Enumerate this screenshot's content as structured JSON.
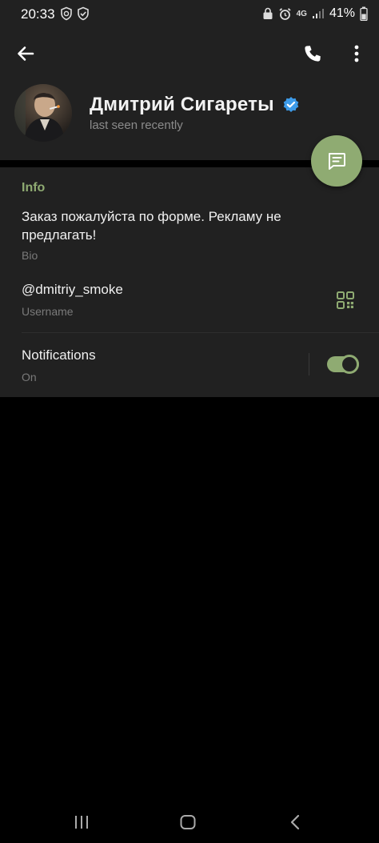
{
  "status_bar": {
    "time": "20:33",
    "network": "4G",
    "battery": "41%",
    "icons": [
      "shield-icon",
      "shield-check-icon",
      "lock-icon",
      "alarm-icon",
      "signal-icon",
      "battery-icon"
    ]
  },
  "toolbar": {
    "back_icon": "arrow-left-icon",
    "call_icon": "phone-icon",
    "more_icon": "more-vertical-icon"
  },
  "profile": {
    "name": "Дмитрий Сигареты",
    "status": "last seen recently",
    "verified": true
  },
  "fab": {
    "icon": "message-icon"
  },
  "info": {
    "title": "Info",
    "bio": "Заказ пожалуйста по форме. Рекламу не предлагать!",
    "bio_label": "Bio",
    "username": "@dmitriy_smoke",
    "username_label": "Username",
    "qr_icon": "qr-code-icon",
    "notifications_label": "Notifications",
    "notifications_value": "On",
    "notifications_enabled": true
  },
  "navigation": {
    "items": [
      "recents-icon",
      "home-icon",
      "back-icon"
    ]
  },
  "colors": {
    "accent": "#8fab72",
    "panel": "#212121",
    "background": "#000000",
    "secondary_text": "#7a7a7a",
    "verified_badge": "#3d9be9"
  }
}
